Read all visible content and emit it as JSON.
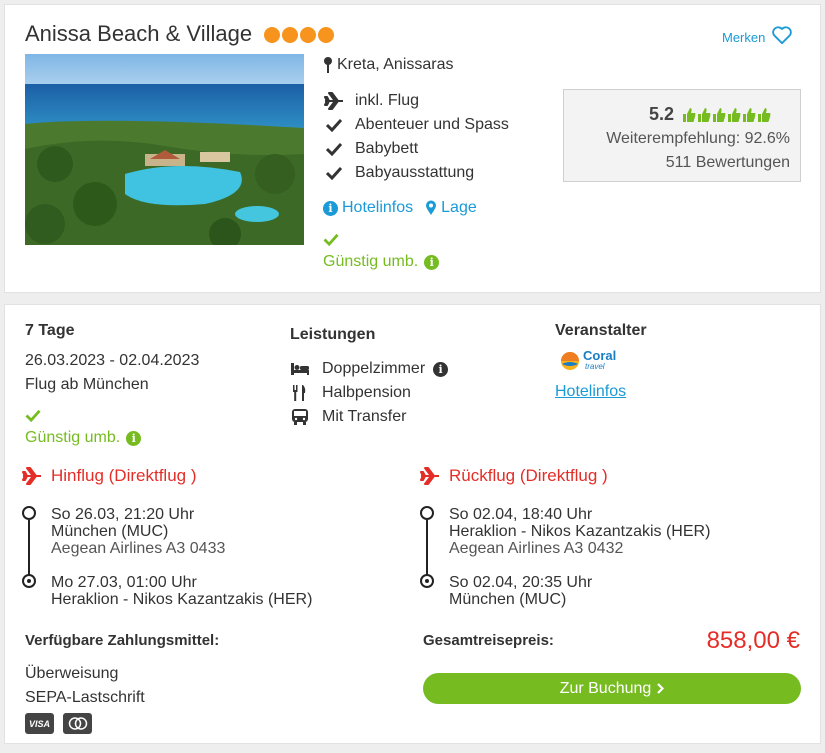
{
  "hotel": {
    "name": "Anissa Beach & Village",
    "stars": 4,
    "save_label": "Merken",
    "location": "Kreta, Anissaras",
    "features": [
      {
        "icon": "plane-icon",
        "label": "inkl. Flug"
      },
      {
        "icon": "check-icon",
        "label": "Abenteuer und Spass"
      },
      {
        "icon": "check-icon",
        "label": "Babybett"
      },
      {
        "icon": "check-icon",
        "label": "Babyausstattung"
      }
    ],
    "links": {
      "hotelinfos": "Hotelinfos",
      "lage": "Lage"
    },
    "rebooking": "Günstig umb."
  },
  "rating": {
    "score": "5.2",
    "thumbs_filled": 6,
    "thumbs_total": 6,
    "recommendation": "Weiterempfehlung: 92.6%",
    "reviews": "511 Bewertungen"
  },
  "offer": {
    "duration": "7 Tage",
    "dates": "26.03.2023 - 02.04.2023",
    "departure": "Flug ab München",
    "rebooking": "Günstig umb.",
    "services_title": "Leistungen",
    "services": [
      {
        "icon": "bed-icon",
        "label": "Doppelzimmer"
      },
      {
        "icon": "cutlery-icon",
        "label": "Halbpension"
      },
      {
        "icon": "bus-icon",
        "label": "Mit Transfer"
      }
    ],
    "operator_title": "Veranstalter",
    "operator_name": "Coral",
    "operator_sub": "travel",
    "operator_link": "Hotelinfos"
  },
  "flights": {
    "outbound": {
      "title": "Hinflug (Direktflug )",
      "dep_time": "So 26.03, 21:20 Uhr",
      "dep_airport": "München (MUC)",
      "airline": "Aegean Airlines A3 0433",
      "arr_time": "Mo 27.03, 01:00 Uhr",
      "arr_airport": "Heraklion - Nikos Kazantzakis (HER)"
    },
    "return": {
      "title": "Rückflug (Direktflug )",
      "dep_time": "So 02.04, 18:40 Uhr",
      "dep_airport": "Heraklion - Nikos Kazantzakis (HER)",
      "airline": "Aegean Airlines A3 0432",
      "arr_time": "So 02.04, 20:35 Uhr",
      "arr_airport": "München (MUC)"
    }
  },
  "payment": {
    "title": "Verfügbare Zahlungsmittel:",
    "methods": [
      "Überweisung",
      "SEPA-Lastschrift"
    ],
    "card_visa": "VISA"
  },
  "price": {
    "label": "Gesamtreisepreis:",
    "value": "858,00 €",
    "button": "Zur Buchung"
  },
  "colors": {
    "accent_green": "#76bc21",
    "link_blue": "#1a9ad6",
    "flight_red": "#e52d27",
    "star_orange": "#f7941d"
  }
}
